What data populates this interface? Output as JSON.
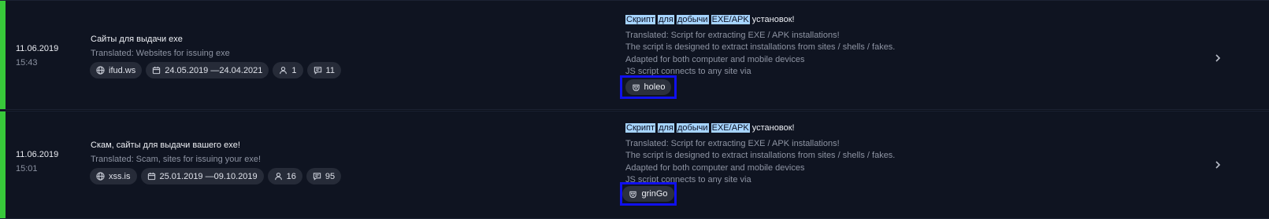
{
  "rows": [
    {
      "date": "11.06.2019",
      "time": "15:43",
      "title": "Сайты для выдачи exe",
      "translated": "Translated: Websites for issuing exe",
      "chips": {
        "site": "ifud.ws",
        "period": "24.05.2019 —24.04.2021",
        "users": "1",
        "comments": "11"
      },
      "post": {
        "headline_highlighted": [
          "Скрипт",
          "для",
          "добычи",
          "EXE/APK"
        ],
        "headline_rest": "установок!",
        "lines": [
          "Translated: Script for extracting EXE / APK installations!",
          "The script is designed to extract installations from sites / shells / fakes.",
          "Adapted for both computer and mobile devices",
          "JS script connects to any site via"
        ]
      },
      "author": "holeo",
      "status_color": "#38c93a"
    },
    {
      "date": "11.06.2019",
      "time": "15:01",
      "title": "Скам, сайты для выдачи вашего exe!",
      "translated": "Translated: Scam, sites for issuing your exe!",
      "chips": {
        "site": "xss.is",
        "period": "25.01.2019 —09.10.2019",
        "users": "16",
        "comments": "95"
      },
      "post": {
        "headline_highlighted": [
          "Скрипт",
          "для",
          "добычи",
          "EXE/APK"
        ],
        "headline_rest": "установок!",
        "lines": [
          "Translated: Script for extracting EXE / APK installations!",
          "The script is designed to extract installations from sites / shells / fakes.",
          "Adapted for both computer and mobile devices",
          "JS script connects to any site via"
        ]
      },
      "author": "grinGo",
      "status_color": "#38c93a"
    }
  ],
  "icons": {
    "site": "globe-icon",
    "period": "calendar-icon",
    "users": "user-icon",
    "comments": "message-icon",
    "author": "mask-icon",
    "open": "chevron-right-icon"
  },
  "colors": {
    "highlight": "#a6d4ff",
    "annotation_box": "#1010ee"
  }
}
